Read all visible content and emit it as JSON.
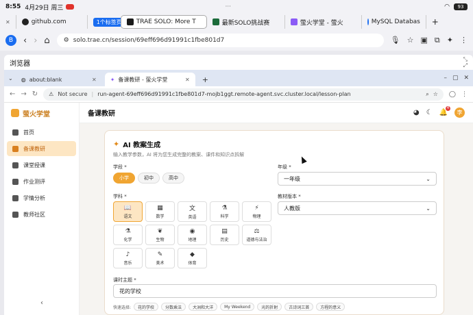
{
  "status_bar": {
    "time": "8:55",
    "date": "4月29日 周三",
    "dots": "···",
    "battery": "93"
  },
  "outer_tabs": [
    {
      "label": "github.com"
    },
    {
      "label": "1个标签页",
      "badge": true
    },
    {
      "label": "TRAE SOLO: More T",
      "active": true
    },
    {
      "label": "最新SOLO挑战赛"
    },
    {
      "label": "萤火学堂 - 萤火"
    },
    {
      "label": "MySQL Databas"
    }
  ],
  "outer_address": {
    "avatar": "B",
    "url": "solo.trae.cn/session/69eff696d91991c1fbe801d7"
  },
  "browser": {
    "window_title": "浏览器",
    "tabs": [
      {
        "label": "about:blank"
      },
      {
        "label": "备课教研 - 萤火学堂",
        "active": true
      }
    ],
    "not_secure": "Not secure",
    "url": "run-agent-69eff696d91991c1fbe801d7-mojb1ggt.remote-agent.svc.cluster.local/lesson-plan"
  },
  "app": {
    "brand": "萤火学堂",
    "page_title": "备课教研",
    "user_initial": "李",
    "notification_count": "4",
    "sidebar": [
      {
        "label": "首页",
        "icon": "grid-icon"
      },
      {
        "label": "备课教研",
        "icon": "pen-icon",
        "active": true
      },
      {
        "label": "课堂授课",
        "icon": "cap-icon"
      },
      {
        "label": "作业测评",
        "icon": "clipboard-icon"
      },
      {
        "label": "学情分析",
        "icon": "chart-icon"
      },
      {
        "label": "教师社区",
        "icon": "people-icon"
      }
    ],
    "card": {
      "title": "AI 教案生成",
      "subtitle": "输入教学参数，AI 将为您生成完整的教案、课件和知识点拆解",
      "stage_label": "学段 *",
      "stages": [
        {
          "label": "小学",
          "active": true
        },
        {
          "label": "初中"
        },
        {
          "label": "高中"
        }
      ],
      "grade_label": "年级 *",
      "grade_value": "一年级",
      "subject_label": "学科 *",
      "subjects": [
        {
          "label": "语文",
          "glyph": "📖",
          "active": true
        },
        {
          "label": "数学",
          "glyph": "▦"
        },
        {
          "label": "英语",
          "glyph": "文"
        },
        {
          "label": "科学",
          "glyph": "⚗"
        },
        {
          "label": "物理",
          "glyph": "⚡"
        },
        {
          "label": "化学",
          "glyph": "⚗"
        },
        {
          "label": "生物",
          "glyph": "❦"
        },
        {
          "label": "地理",
          "glyph": "◉"
        },
        {
          "label": "历史",
          "glyph": "▤"
        },
        {
          "label": "道德与法治",
          "glyph": "⚖"
        },
        {
          "label": "音乐",
          "glyph": "♪"
        },
        {
          "label": "美术",
          "glyph": "✎"
        },
        {
          "label": "体育",
          "glyph": "◆"
        }
      ],
      "edition_label": "教材版本 *",
      "edition_value": "人教版",
      "topic_label": "课时主题 *",
      "topic_value": "花的学校",
      "quick_label": "快速选择:",
      "quick_chips": [
        "花的学校",
        "分数乘法",
        "大洲和大洋",
        "My Weekend",
        "光的折射",
        "古诗词三首",
        "方程的意义"
      ]
    }
  }
}
